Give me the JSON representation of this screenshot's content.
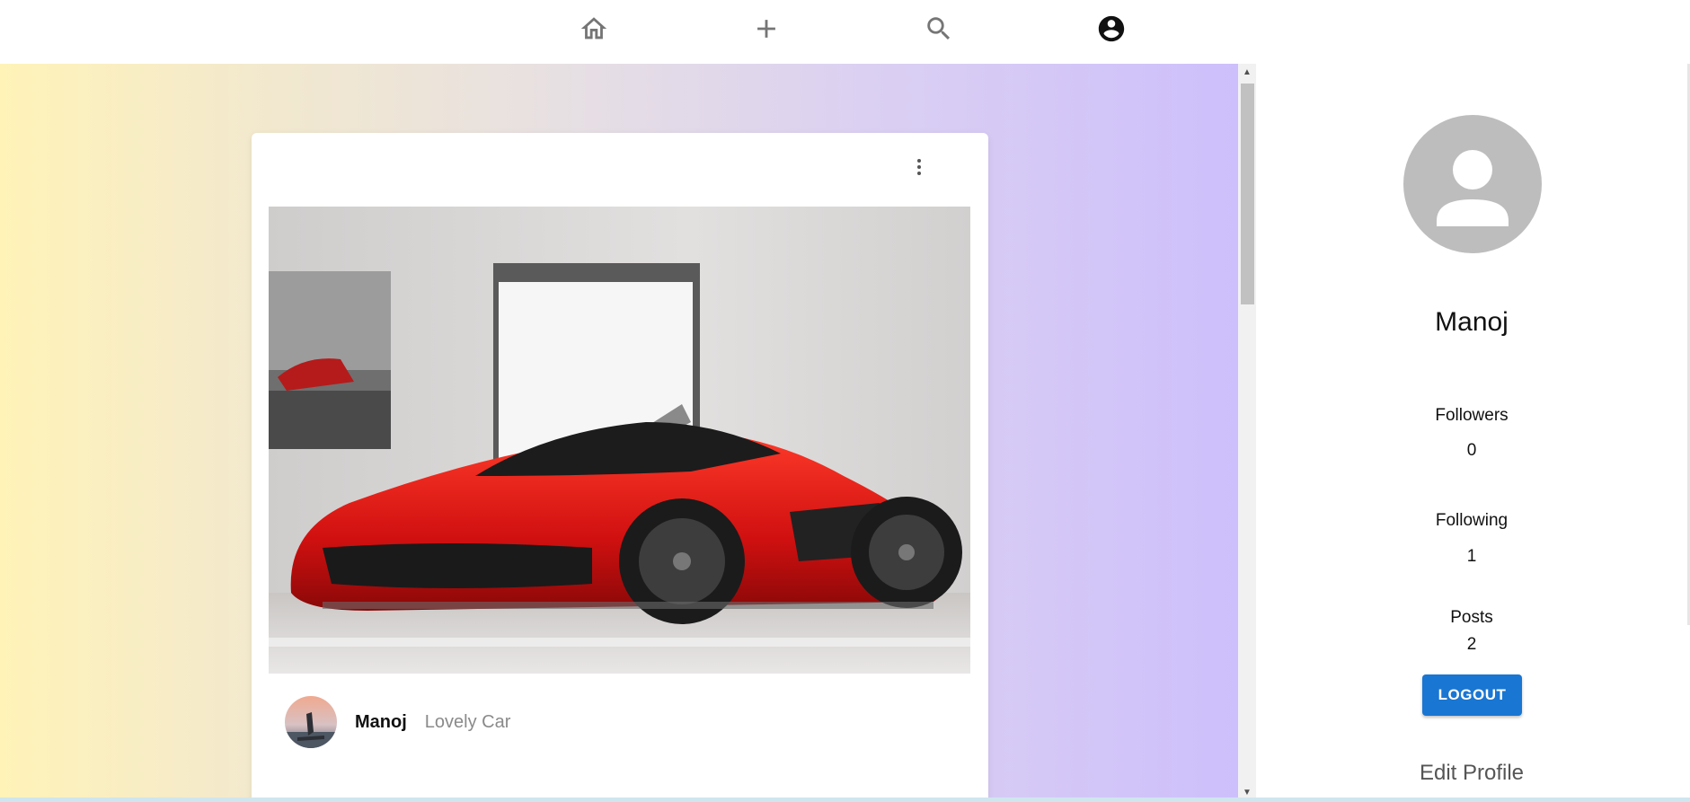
{
  "nav": {
    "items": [
      {
        "name": "home",
        "icon": "home-icon"
      },
      {
        "name": "add",
        "icon": "plus-icon"
      },
      {
        "name": "search",
        "icon": "search-icon"
      },
      {
        "name": "profile",
        "icon": "account-circle-icon"
      }
    ]
  },
  "post": {
    "username": "Manoj",
    "caption": "Lovely Car",
    "menu_icon": "more-vert-icon",
    "image_icon": "red-sports-car-photo"
  },
  "profile": {
    "name": "Manoj",
    "followers_label": "Followers",
    "followers_value": "0",
    "following_label": "Following",
    "following_value": "1",
    "posts_label": "Posts",
    "posts_value": "2",
    "logout_label": "LOGOUT",
    "edit_profile_label": "Edit Profile"
  },
  "colors": {
    "accent": "#1976d2",
    "avatar_placeholder": "#bdbdbd",
    "gradient_start": "#fff3b8",
    "gradient_end": "#cdbffb"
  }
}
